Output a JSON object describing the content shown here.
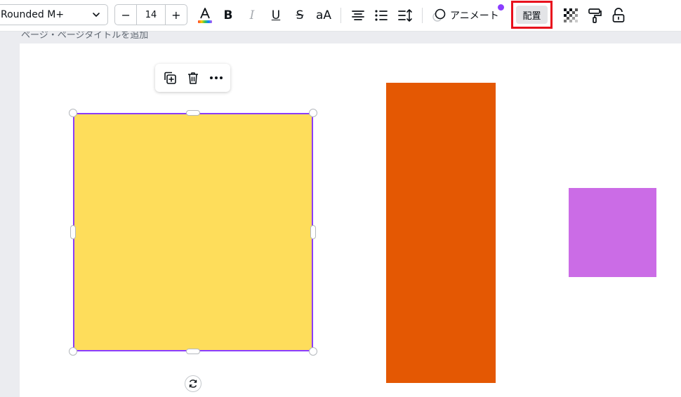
{
  "toolbar": {
    "font_name": "Rounded M+",
    "font_size": "14",
    "minus_label": "−",
    "plus_label": "+",
    "bold_label": "B",
    "italic_label": "I",
    "underline_label": "U",
    "strike_label": "S",
    "case_label": "aA",
    "animate_label": "アニメート",
    "arrange_label": "配置"
  },
  "subbar": {
    "page_text": "ページ・ページタイトルを追加"
  },
  "colors": {
    "yellow_shape": "#fedd5b",
    "orange_shape": "#e45803",
    "purple_shape": "#cb6ce6",
    "selection": "#8b3dff",
    "highlight": "#e8101d"
  },
  "icons": {
    "chevron": "chevron-down-icon",
    "text_color": "text-color-icon",
    "align": "align-center-icon",
    "list": "bullet-list-icon",
    "spacing": "line-spacing-icon",
    "animate": "animate-icon",
    "transparency": "transparency-icon",
    "style_copy": "paint-roller-icon",
    "lock": "unlock-icon",
    "duplicate": "duplicate-icon",
    "delete": "trash-icon",
    "more": "more-icon",
    "rotate": "rotate-icon"
  }
}
